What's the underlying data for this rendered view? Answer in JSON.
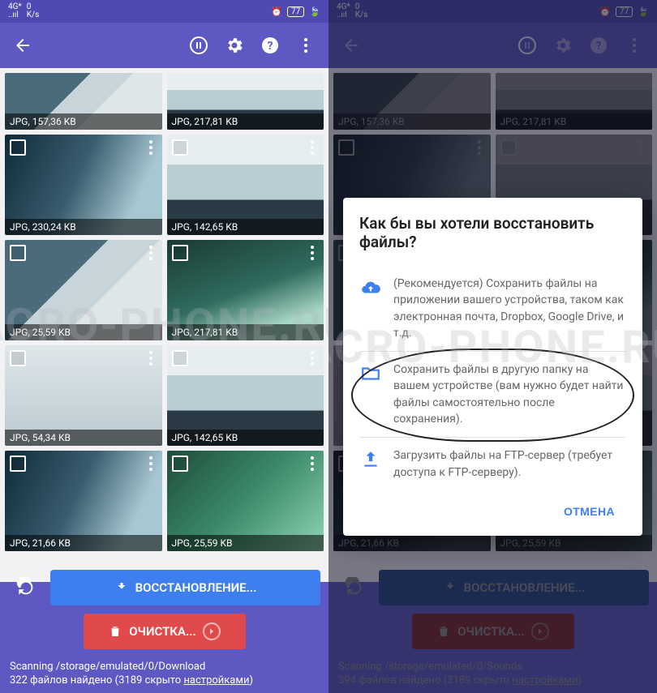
{
  "status": {
    "netspeed_top": "0",
    "netspeed_unit": "K/s",
    "sig_label": "4G*",
    "battery": "77"
  },
  "watermark": "ACRO-PHONE.RU",
  "left": {
    "grid": [
      {
        "label": "JPG, 157,36 KB",
        "cls": "ph1",
        "short": true
      },
      {
        "label": "JPG, 217,81 KB",
        "cls": "ph2",
        "short": true
      },
      {
        "label": "JPG, 230,24 KB",
        "cls": "ph3"
      },
      {
        "label": "JPG, 142,65 KB",
        "cls": "ph2"
      },
      {
        "label": "JPG, 25,59 KB",
        "cls": "ph1"
      },
      {
        "label": "JPG, 217,81 KB",
        "cls": "ph4"
      },
      {
        "label": "JPG, 54,34 KB",
        "cls": "ph5"
      },
      {
        "label": "JPG, 142,65 KB",
        "cls": "ph2"
      },
      {
        "label": "JPG, 21,66 KB",
        "cls": "ph3"
      },
      {
        "label": "JPG, 25,59 KB",
        "cls": "ph6"
      }
    ],
    "buttons": {
      "restore": "ВОССТАНОВЛЕНИЕ...",
      "clean": "ОЧИСТКА..."
    },
    "footer_path": "Scanning /storage/emulated/0/Download",
    "footer_count": "322 файлов найдено (3189 скрыто ",
    "footer_link": "настройками",
    "footer_tail": ")"
  },
  "right": {
    "grid": [
      {
        "label": "JPG, 157,36 KB",
        "cls": "ph1",
        "short": true
      },
      {
        "label": "JPG, 217,81 KB",
        "cls": "ph2",
        "short": true
      },
      {
        "label": "",
        "cls": "ph3"
      },
      {
        "label": "",
        "cls": "ph2"
      },
      {
        "label": "",
        "cls": "ph1"
      },
      {
        "label": "",
        "cls": "ph4"
      },
      {
        "label": "",
        "cls": "ph5"
      },
      {
        "label": "",
        "cls": "ph2"
      },
      {
        "label": "JPG, 21,66 KB",
        "cls": "ph3"
      },
      {
        "label": "JPG, 25,59 KB",
        "cls": "ph6"
      }
    ],
    "buttons": {
      "restore": "ВОССТАНОВЛЕНИЕ...",
      "clean": "ОЧИСТКА..."
    },
    "footer_path": "Scanning /storage/emulated/0/Sounds",
    "footer_count": "394 файлов найдено (3189 скрыто ",
    "footer_link": "настройками",
    "footer_tail": ")",
    "dialog": {
      "title": "Как бы вы хотели восстановить файлы?",
      "opt1": "(Рекомендуется) Сохранить файлы на приложении вашего устройства, таком как электронная почта, Dropbox, Google Drive, и т.д.",
      "opt2": "Сохранить файлы в другую папку на вашем устройстве (вам нужно будет найти файлы самостоятельно после сохранения).",
      "opt3": "Загрузить файлы на FTP-сервер (требует доступа к FTP-серверу).",
      "cancel": "ОТМЕНА"
    }
  }
}
